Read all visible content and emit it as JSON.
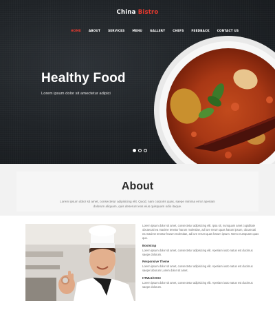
{
  "brand": {
    "name_part1": "China",
    "name_part2": "Bistro"
  },
  "nav": {
    "items": [
      "HOME",
      "ABOUT",
      "SERVICES",
      "MENU",
      "GALLERY",
      "CHEFS",
      "FEEDBACK",
      "CONTACT US"
    ],
    "active_index": 0
  },
  "hero": {
    "title": "Healthy Food",
    "subtitle": "Lorem ipsum dolor sit amectetur adipici",
    "slides_count": 3,
    "active_slide": 0
  },
  "about": {
    "title": "About",
    "text": "Lorem ipsum dolor sit amet, consectetur adipisicing elit. Quod, nam corporis quas, saepe minima error aperiam dolorum aliquam, quis deserunt eos eius quisquam odio itaque."
  },
  "features": {
    "intro": "Lorem ipsum dolor sit amet, consectetur adipisicing elit. Ipsa sit, numquam amet cupiditate obcaecati ea maxime tenetur harum molestiae, ad iure rerum quas harum ipsum, obcaecati ea maxime tenetur harum molestiae, ad iure rerum quas harum ipsum. Nemo numquam quas quo.",
    "items": [
      {
        "heading": "Bootstrap",
        "text": "Lorem ipsum dolor sit amet, consectetur adipisicing elit. Aperiam iusto natus est ducimus saepe dolorum."
      },
      {
        "heading": "Responsive Theme",
        "text": "Lorem ipsum dolor sit amet, consectetur adipisicing elit. Aperiam iusto natus est ducimus saepe laborum Lorem dolor sit amet."
      },
      {
        "heading": "HTML5/CSS3",
        "text": "Lorem ipsum dolor sit amet, consectetur adipisicing elit. Aperiam iusto natus est ducimus saepe dolorum."
      }
    ]
  },
  "colors": {
    "accent": "#e53a2f",
    "hero_bg": "#1f2327",
    "band_bg": "#f2f2f2"
  },
  "icons": {
    "slide_dot": "circle",
    "hero_image": "curry-plate-photo",
    "chef_image": "chef-ok-gesture-photo"
  }
}
